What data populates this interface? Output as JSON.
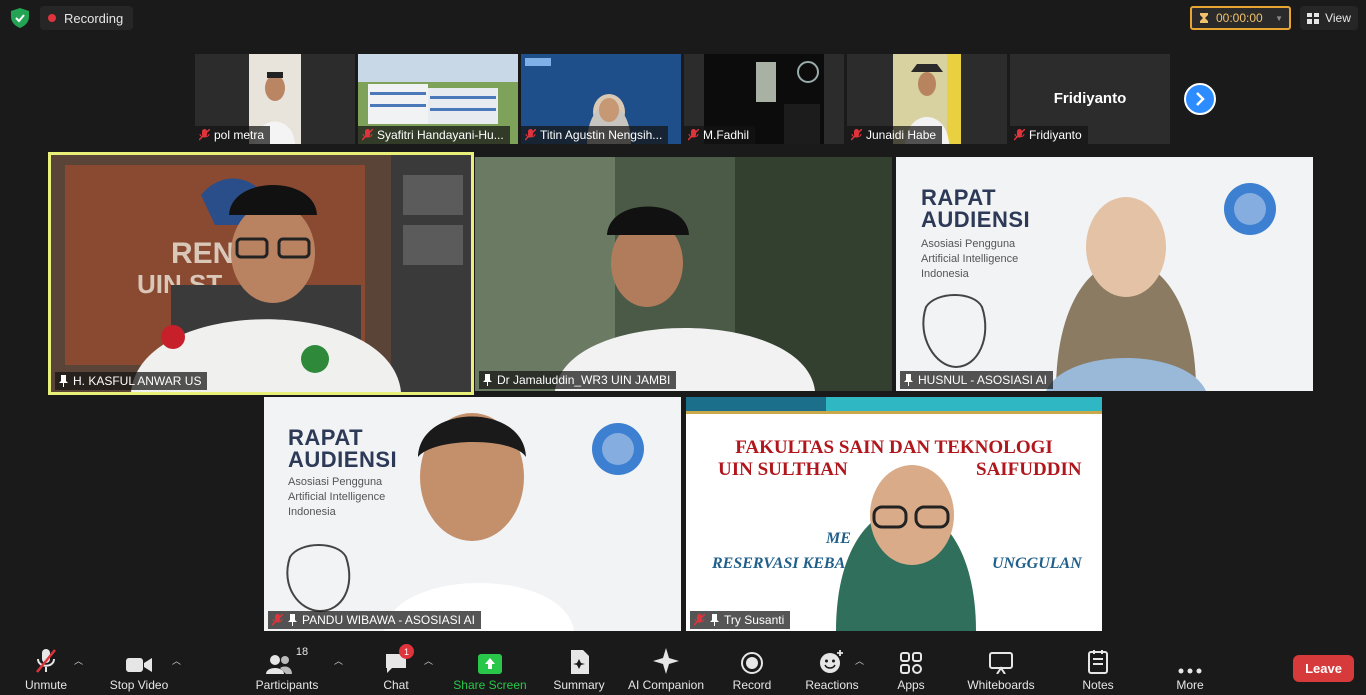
{
  "meeting": {
    "recording_label": "Recording",
    "timer": "00:00:00",
    "view_label": "View"
  },
  "strip": [
    {
      "name": "pol metra"
    },
    {
      "name": "Syafitri Handayani-Hu..."
    },
    {
      "name": "Titin Agustin Nengsih..."
    },
    {
      "name": "M.Fadhil"
    },
    {
      "name": "Junaidi Habe"
    },
    {
      "name": "Fridiyanto",
      "display_name": "Fridiyanto"
    }
  ],
  "tiles": [
    {
      "name": "H. KASFUL ANWAR US"
    },
    {
      "name": "Dr Jamaluddin_WR3 UIN JAMBI"
    },
    {
      "name": "HUSNUL - ASOSIASI AI"
    },
    {
      "name": "PANDU WIBAWA - ASOSIASI AI"
    },
    {
      "name": "Try Susanti"
    }
  ],
  "slide": {
    "title_line1": "RAPAT",
    "title_line2": "AUDIENSI",
    "subtitle": [
      "Asosiasi Pengguna",
      "Artificial Intelligence",
      "Indonesia"
    ]
  },
  "banner": {
    "line1": "FAKULTAS SAIN DAN TEKNOLOGI",
    "line2": "UIN SULTHAN",
    "line2b": "SAIFUDDIN",
    "line3": "ME",
    "line4a": "RESERVASI KEBA",
    "line4b": "UNGGULAN"
  },
  "toolbar": {
    "unmute": "Unmute",
    "stop_video": "Stop Video",
    "participants": "Participants",
    "participants_count": "18",
    "chat": "Chat",
    "chat_badge": "1",
    "share_screen": "Share Screen",
    "summary": "Summary",
    "ai_companion": "AI Companion",
    "record": "Record",
    "reactions": "Reactions",
    "apps": "Apps",
    "whiteboards": "Whiteboards",
    "notes": "Notes",
    "more": "More",
    "leave": "Leave"
  },
  "colors": {
    "accent": "#2d8cff",
    "share_green": "#28c74a",
    "leave_red": "#d63a3a",
    "active_speaker": "#e9f07a",
    "timer": "#e8a531"
  },
  "icons": [
    "shield-icon",
    "recording-dot-icon",
    "timer-icon",
    "view-grid-icon",
    "mic-muted-icon",
    "pin-icon",
    "chevron-right-icon",
    "video-icon",
    "participants-icon",
    "chat-icon",
    "share-screen-icon",
    "summary-icon",
    "ai-companion-icon",
    "record-icon",
    "reactions-icon",
    "apps-icon",
    "whiteboard-icon",
    "notes-icon",
    "more-icon"
  ]
}
